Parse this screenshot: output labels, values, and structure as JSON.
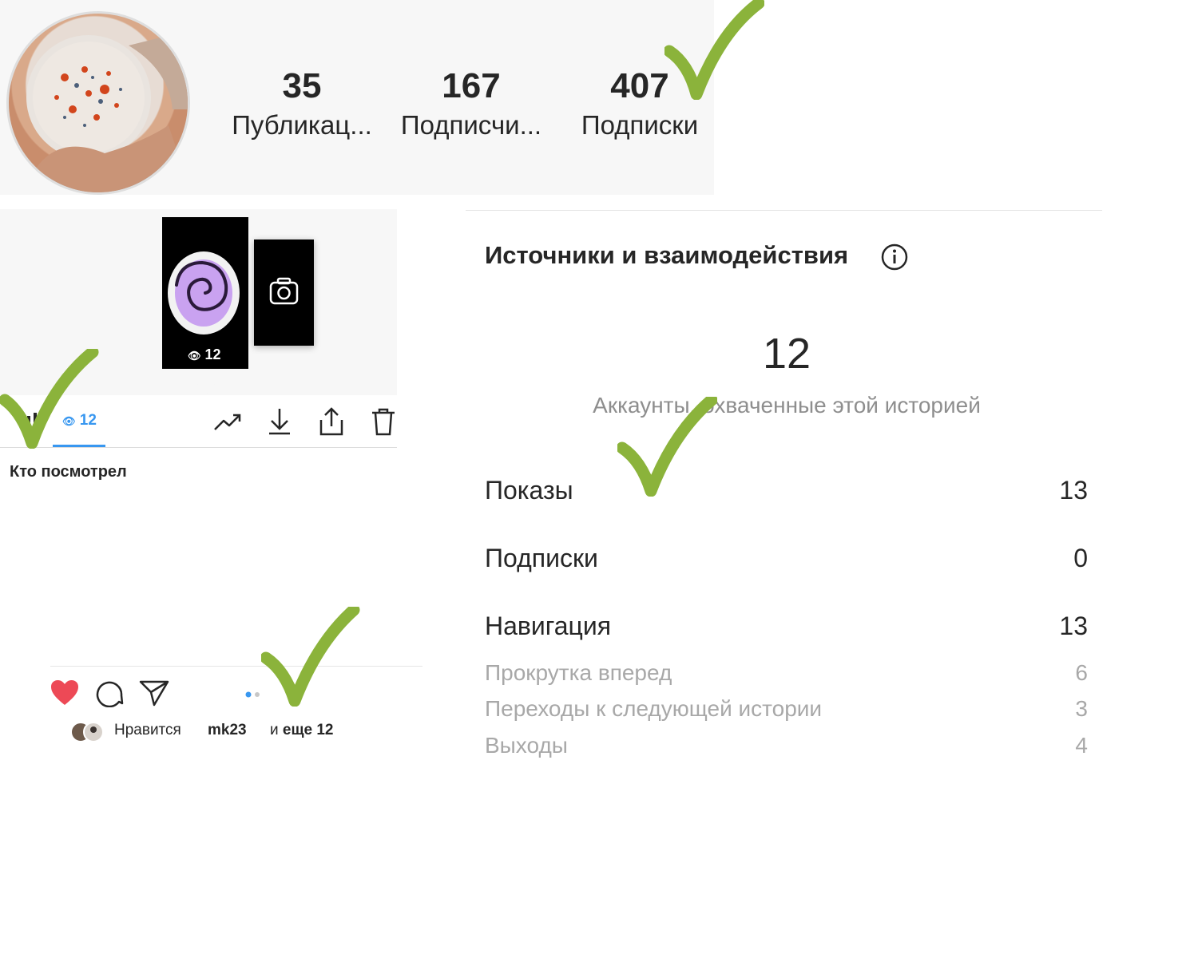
{
  "profile": {
    "stats": [
      {
        "value": "35",
        "label": "Публикац..."
      },
      {
        "value": "167",
        "label": "Подписчи..."
      },
      {
        "value": "407",
        "label": "Подписки"
      }
    ]
  },
  "story": {
    "thumb_views": "12",
    "viewers_tab_count": "12",
    "viewers_heading": "Кто посмотрел",
    "tools": [
      "trending-icon",
      "download-icon",
      "share-icon",
      "trash-icon"
    ]
  },
  "post": {
    "likes_prefix": "Нравится",
    "likes_user": "mk23",
    "likes_and": "и",
    "likes_more": "еще 12"
  },
  "insights": {
    "title": "Источники и взаимодействия",
    "reach_value": "12",
    "reach_label": "Аккаунты, охваченные этой историей",
    "metrics": [
      {
        "label": "Показы",
        "value": "13"
      },
      {
        "label": "Подписки",
        "value": "0"
      },
      {
        "label": "Навигация",
        "value": "13"
      }
    ],
    "navigation_details": [
      {
        "label": "Прокрутка вперед",
        "value": "6"
      },
      {
        "label": "Переходы к следующей истории",
        "value": "3"
      },
      {
        "label": "Выходы",
        "value": "4"
      }
    ]
  },
  "colors": {
    "accent_blue": "#3897f0",
    "like_red": "#ed4956",
    "check_green": "#8bb33b",
    "muted_text": "#8e8e8e"
  }
}
